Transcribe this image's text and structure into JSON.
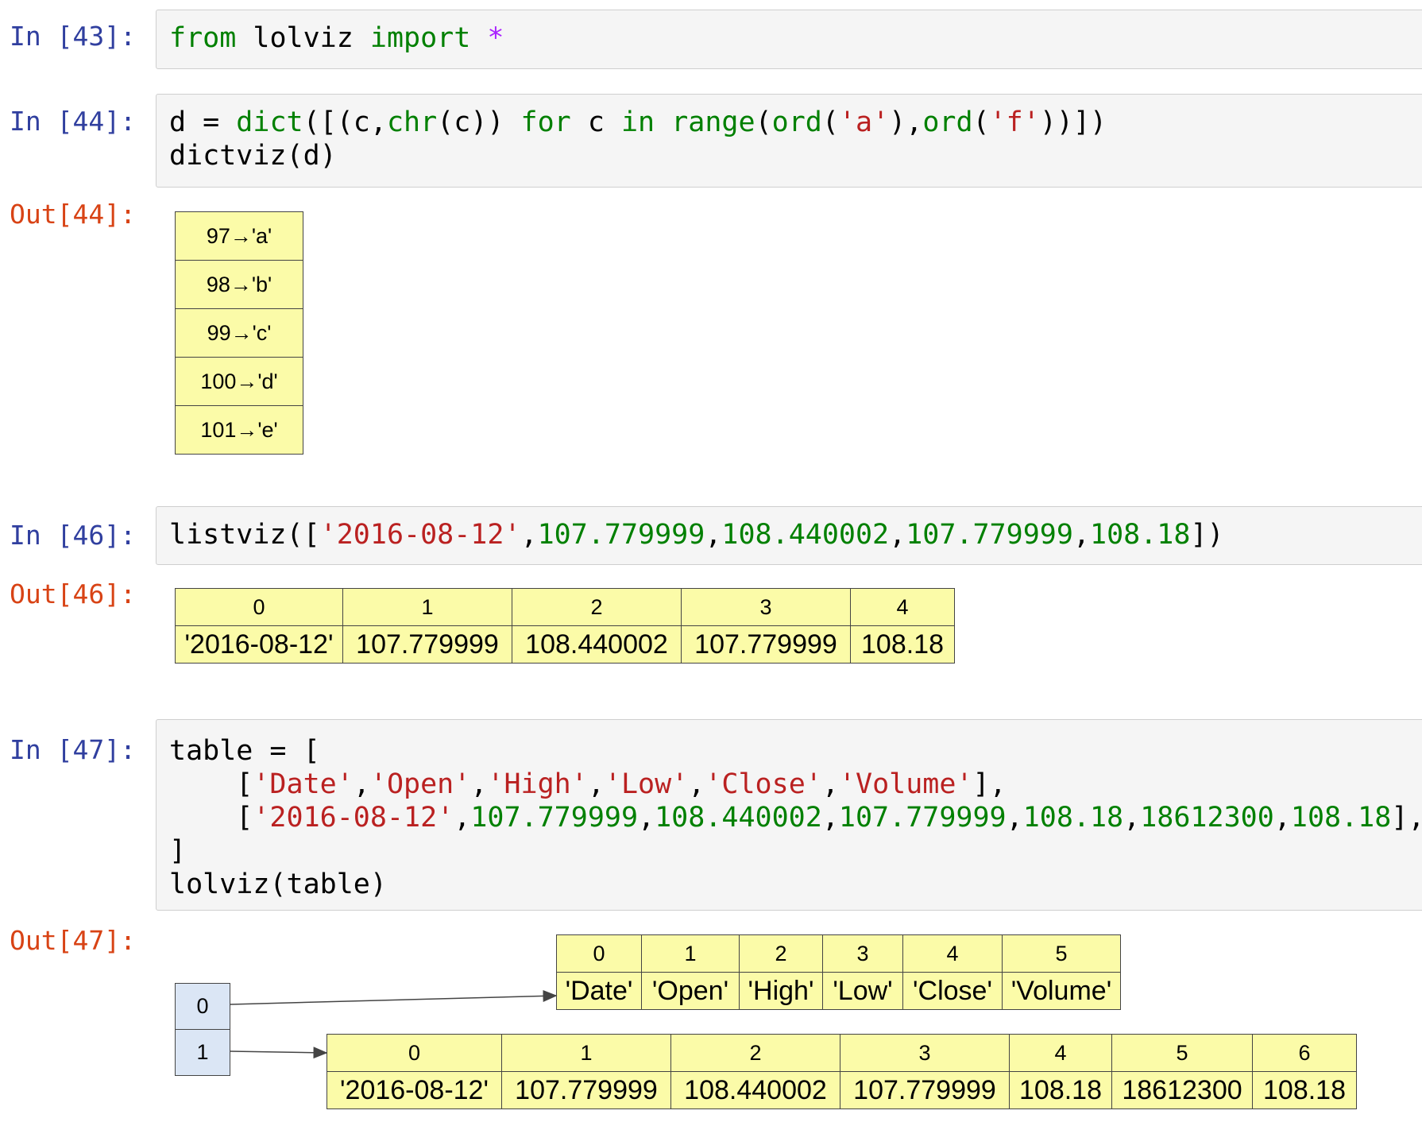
{
  "cells": [
    {
      "in_prompt": "In [43]:",
      "code_lines": [
        [
          {
            "t": "from",
            "c": "kw"
          },
          {
            "t": " lolviz ",
            "c": ""
          },
          {
            "t": "import",
            "c": "kw"
          },
          {
            "t": " ",
            "c": ""
          },
          {
            "t": "*",
            "c": "op"
          }
        ]
      ]
    },
    {
      "in_prompt": "In [44]:",
      "out_prompt": "Out[44]:",
      "code_lines": [
        [
          {
            "t": "d = ",
            "c": ""
          },
          {
            "t": "dict",
            "c": "kw"
          },
          {
            "t": "([(c,",
            "c": ""
          },
          {
            "t": "chr",
            "c": "kw"
          },
          {
            "t": "(c)) ",
            "c": ""
          },
          {
            "t": "for",
            "c": "kw"
          },
          {
            "t": " c ",
            "c": ""
          },
          {
            "t": "in",
            "c": "kw"
          },
          {
            "t": " ",
            "c": ""
          },
          {
            "t": "range",
            "c": "kw"
          },
          {
            "t": "(",
            "c": ""
          },
          {
            "t": "ord",
            "c": "kw"
          },
          {
            "t": "(",
            "c": ""
          },
          {
            "t": "'a'",
            "c": "str"
          },
          {
            "t": "),",
            "c": ""
          },
          {
            "t": "ord",
            "c": "kw"
          },
          {
            "t": "(",
            "c": ""
          },
          {
            "t": "'f'",
            "c": "str"
          },
          {
            "t": "))])",
            "c": ""
          }
        ],
        [
          {
            "t": "dictviz(d)",
            "c": ""
          }
        ]
      ]
    },
    {
      "in_prompt": "In [46]:",
      "out_prompt": "Out[46]:",
      "code_lines": [
        [
          {
            "t": "listviz([",
            "c": ""
          },
          {
            "t": "'2016-08-12'",
            "c": "str"
          },
          {
            "t": ",",
            "c": ""
          },
          {
            "t": "107.779999",
            "c": "num"
          },
          {
            "t": ",",
            "c": ""
          },
          {
            "t": "108.440002",
            "c": "num"
          },
          {
            "t": ",",
            "c": ""
          },
          {
            "t": "107.779999",
            "c": "num"
          },
          {
            "t": ",",
            "c": ""
          },
          {
            "t": "108.18",
            "c": "num"
          },
          {
            "t": "])",
            "c": ""
          }
        ]
      ]
    },
    {
      "in_prompt": "In [47]:",
      "out_prompt": "Out[47]:",
      "code_lines": [
        [
          {
            "t": "table = [",
            "c": ""
          }
        ],
        [
          {
            "t": "    [",
            "c": ""
          },
          {
            "t": "'Date'",
            "c": "str"
          },
          {
            "t": ",",
            "c": ""
          },
          {
            "t": "'Open'",
            "c": "str"
          },
          {
            "t": ",",
            "c": ""
          },
          {
            "t": "'High'",
            "c": "str"
          },
          {
            "t": ",",
            "c": ""
          },
          {
            "t": "'Low'",
            "c": "str"
          },
          {
            "t": ",",
            "c": ""
          },
          {
            "t": "'Close'",
            "c": "str"
          },
          {
            "t": ",",
            "c": ""
          },
          {
            "t": "'Volume'",
            "c": "str"
          },
          {
            "t": "],",
            "c": ""
          }
        ],
        [
          {
            "t": "    [",
            "c": ""
          },
          {
            "t": "'2016-08-12'",
            "c": "str"
          },
          {
            "t": ",",
            "c": ""
          },
          {
            "t": "107.779999",
            "c": "num"
          },
          {
            "t": ",",
            "c": ""
          },
          {
            "t": "108.440002",
            "c": "num"
          },
          {
            "t": ",",
            "c": ""
          },
          {
            "t": "107.779999",
            "c": "num"
          },
          {
            "t": ",",
            "c": ""
          },
          {
            "t": "108.18",
            "c": "num"
          },
          {
            "t": ",",
            "c": ""
          },
          {
            "t": "18612300",
            "c": "num"
          },
          {
            "t": ",",
            "c": ""
          },
          {
            "t": "108.18",
            "c": "num"
          },
          {
            "t": "],",
            "c": ""
          }
        ],
        [
          {
            "t": "]",
            "c": ""
          }
        ],
        [
          {
            "t": "lolviz(table)",
            "c": ""
          }
        ]
      ]
    }
  ],
  "dict_viz": [
    "97→'a'",
    "98→'b'",
    "99→'c'",
    "100→'d'",
    "101→'e'"
  ],
  "list_viz": {
    "indices": [
      "0",
      "1",
      "2",
      "3",
      "4"
    ],
    "values": [
      "'2016-08-12'",
      "107.779999",
      "108.440002",
      "107.779999",
      "108.18"
    ]
  },
  "lol_viz": {
    "outer_indices": [
      "0",
      "1"
    ],
    "row0": {
      "indices": [
        "0",
        "1",
        "2",
        "3",
        "4",
        "5"
      ],
      "values": [
        "'Date'",
        "'Open'",
        "'High'",
        "'Low'",
        "'Close'",
        "'Volume'"
      ]
    },
    "row1": {
      "indices": [
        "0",
        "1",
        "2",
        "3",
        "4",
        "5",
        "6"
      ],
      "values": [
        "'2016-08-12'",
        "107.779999",
        "108.440002",
        "107.779999",
        "108.18",
        "18612300",
        "108.18"
      ]
    }
  },
  "colors": {
    "prompt_in": "#303f9f",
    "prompt_out": "#d84315",
    "keyword": "#008000",
    "string": "#ba2121",
    "cell_bg": "#f5f5f5",
    "viz_yellow": "#fbfba8",
    "viz_blue": "#dbe6f5"
  }
}
